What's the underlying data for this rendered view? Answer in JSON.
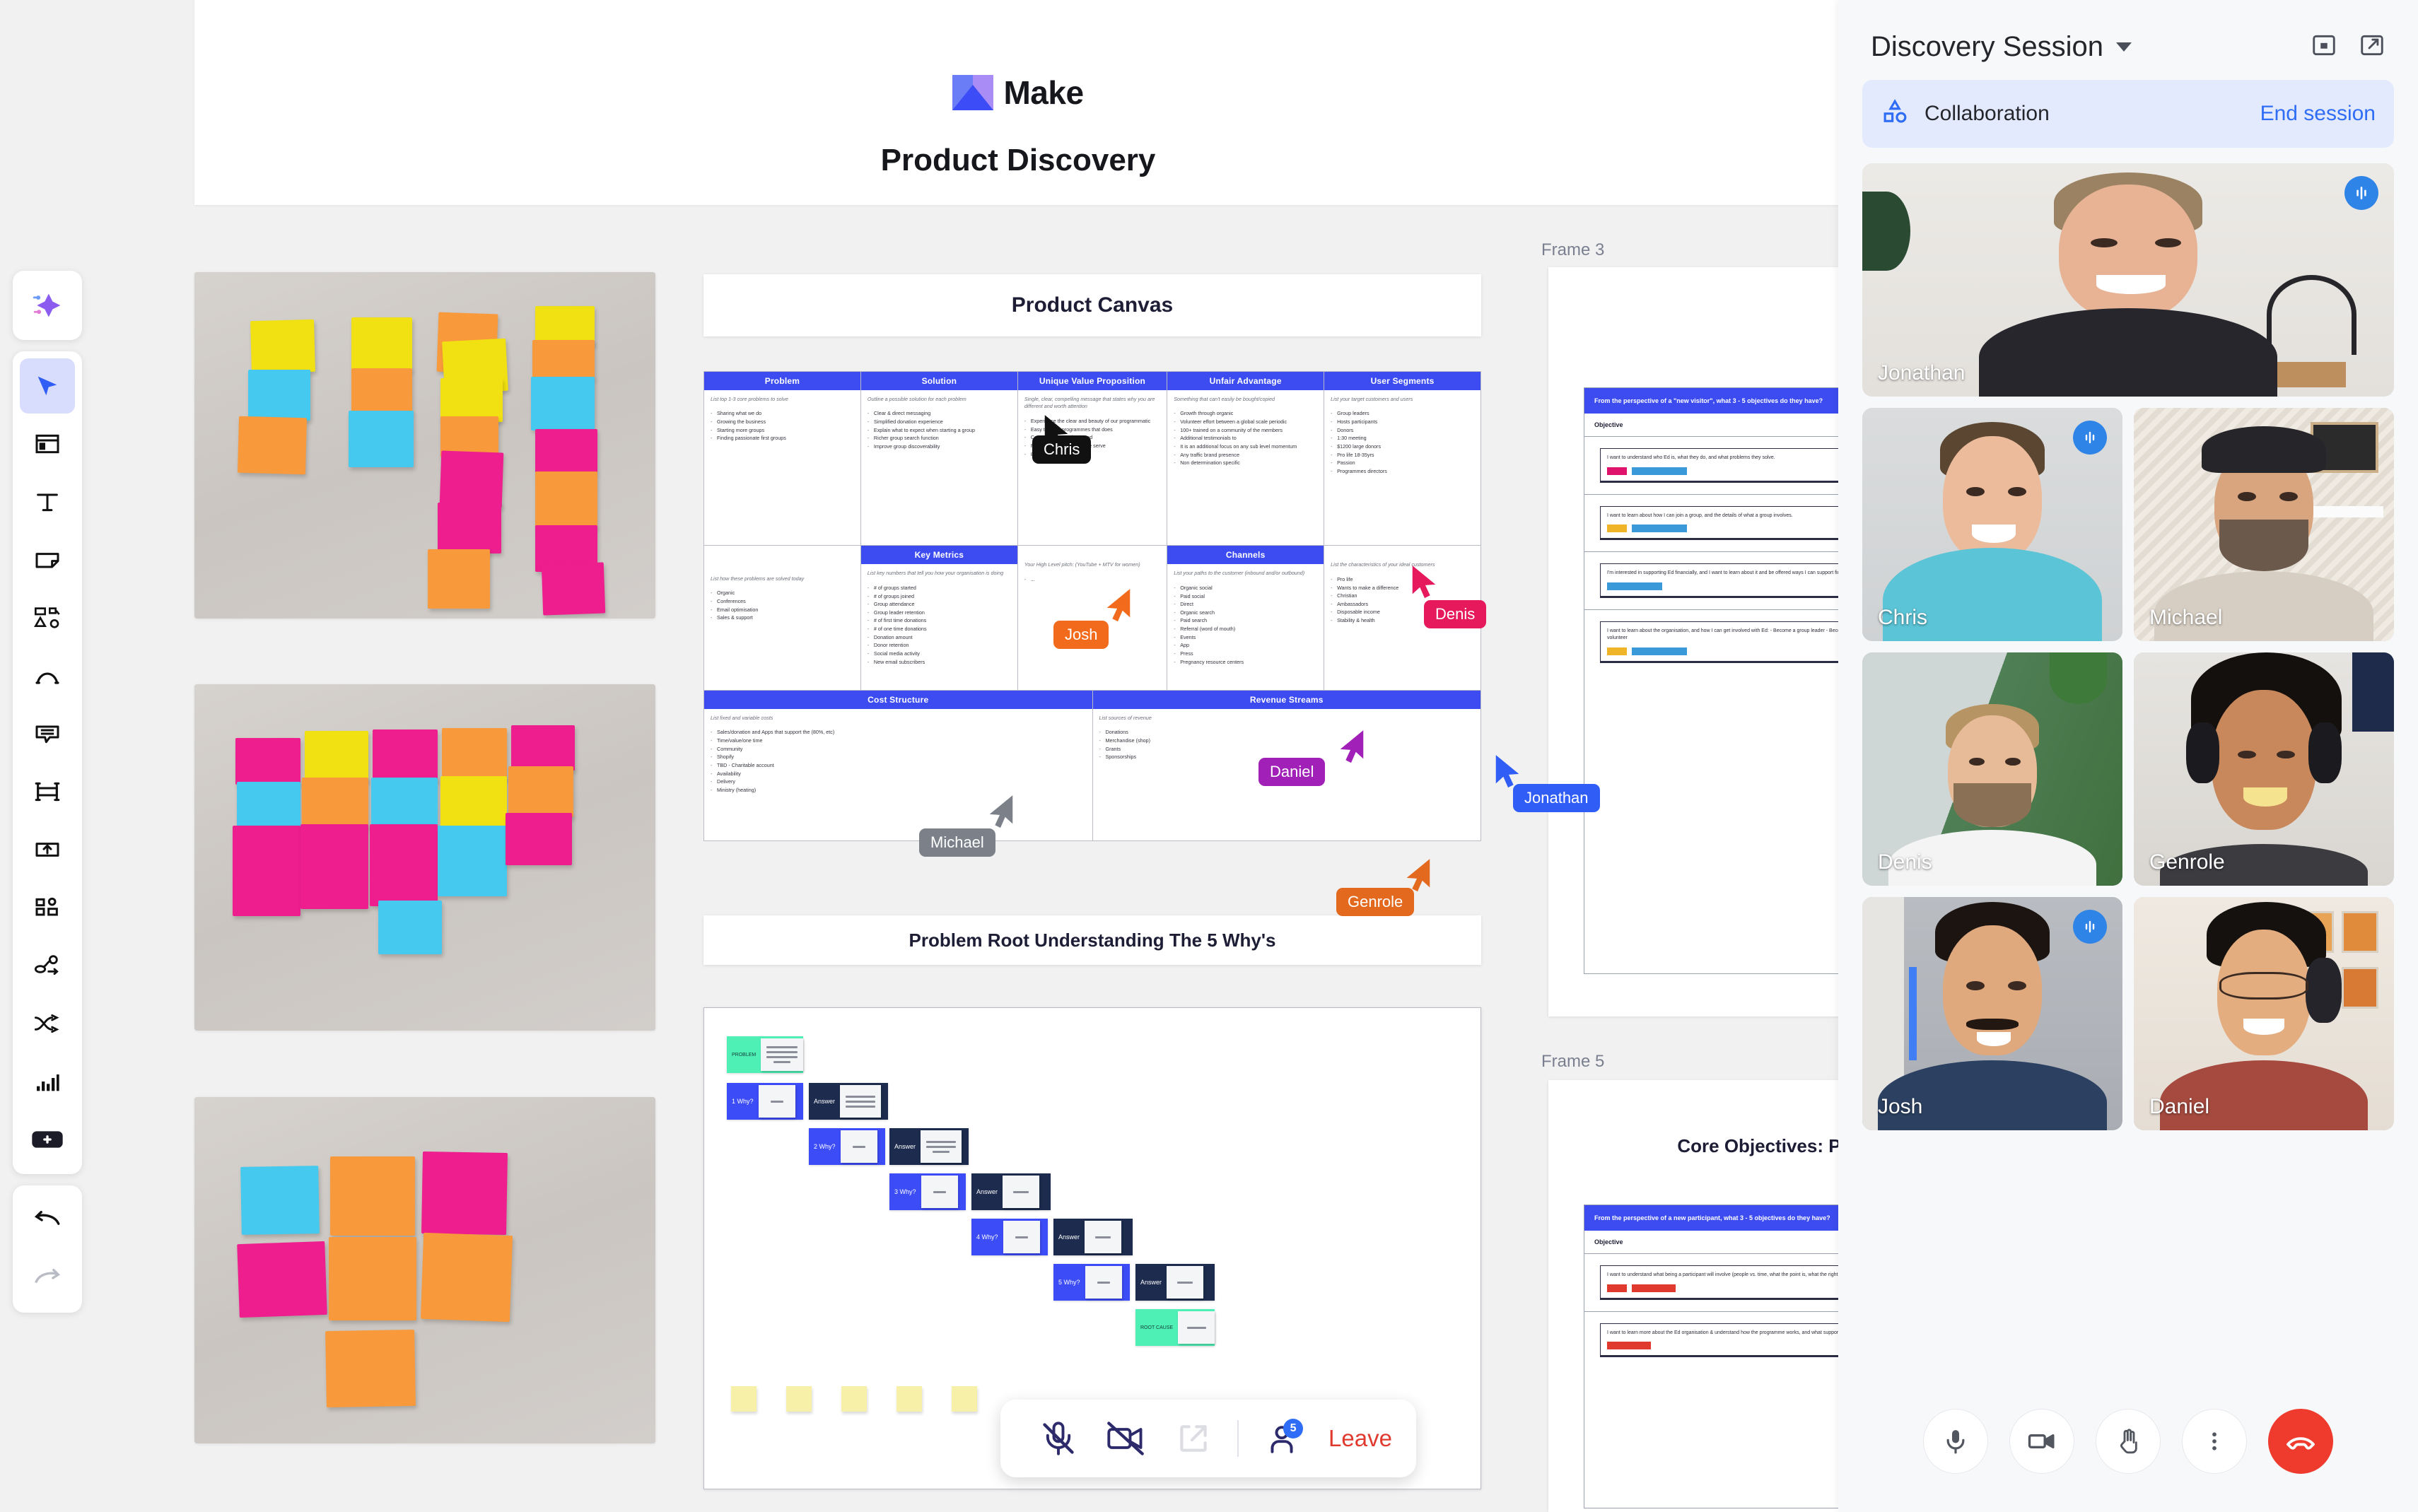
{
  "board": {
    "brand_name": "Make",
    "title": "Product Discovery"
  },
  "toolbar": {
    "items": [
      {
        "name": "ai-assist-icon",
        "label": "AI assist"
      },
      {
        "name": "select-tool",
        "label": "Select",
        "active": true
      },
      {
        "name": "frame-tool",
        "label": "Frame"
      },
      {
        "name": "text-tool",
        "label": "Text"
      },
      {
        "name": "sticky-note-tool",
        "label": "Sticky note"
      },
      {
        "name": "shapes-tool",
        "label": "Shapes"
      },
      {
        "name": "pen-tool",
        "label": "Pen"
      },
      {
        "name": "comment-tool",
        "label": "Comment"
      },
      {
        "name": "table-tool",
        "label": "Table"
      },
      {
        "name": "upload-tool",
        "label": "Upload"
      },
      {
        "name": "apps-tool",
        "label": "Apps"
      },
      {
        "name": "flow-tool",
        "label": "Flow"
      },
      {
        "name": "connector-tool",
        "label": "Connector"
      },
      {
        "name": "chart-tool",
        "label": "Chart"
      },
      {
        "name": "more-tool",
        "label": "More"
      },
      {
        "name": "undo-button",
        "label": "Undo"
      },
      {
        "name": "redo-button",
        "label": "Redo"
      }
    ]
  },
  "canvas": {
    "frames": [
      {
        "label": "Frame 3"
      },
      {
        "label": "Frame 5"
      }
    ],
    "product_canvas": {
      "title": "Product Canvas",
      "columns": [
        {
          "header": "Problem",
          "hint": "List top 1-3 core problems to solve",
          "items": [
            "Sharing what we do",
            "Growing the business",
            "Starting more groups",
            "Finding passionate first groups"
          ]
        },
        {
          "header": "Solution",
          "hint": "Outline a possible solution for each problem",
          "items": [
            "Clear & direct messaging",
            "Simplified donation experience",
            "Explain what to expect when starting a group",
            "Richer group search function",
            "Improve group discoverability"
          ]
        },
        {
          "header": "Unique Value Proposition",
          "hint": "Single, clear, compelling message that states why you are different and worth attention",
          "items": [
            "Experience the clear and beauty of our programmatic",
            "Easy to bring programmes that does",
            "Compel message is around",
            "Focused on the leaders we serve",
            "87% validation rate"
          ]
        },
        {
          "header": "Unfair Advantage",
          "hint": "Something that can't easily be bought/copied",
          "items": [
            "Growth through organic",
            "Volunteer effort between a global scale periodic",
            "100+ trained on a community of the members",
            "Additional testimonials to",
            "It is an additional focus on any sub level momentum",
            "Any traffic brand presence",
            "Non determination specific"
          ]
        },
        {
          "header": "User Segments",
          "hint": "List your target customers and users",
          "items": [
            "Group leaders",
            "Hosts participants",
            "Donors",
            "1:30 meeting",
            "$1200 large donors",
            "Pro life 18-35yrs",
            "Passion",
            "Programmes directors"
          ]
        }
      ],
      "mid_row": [
        {
          "header": "Key Metrics",
          "hint": "List key numbers that tell you how your organisation is doing",
          "items": [
            "# of groups started",
            "# of groups joined",
            "Group attendance",
            "Group leader retention",
            "# of first time donations",
            "# of one time donations",
            "Donation amount",
            "Donor retention",
            "Social media activity",
            "New email subscribers"
          ]
        },
        {
          "header": "Channels",
          "hint": "List your paths to the customer (inbound and/or outbound)",
          "items": [
            "Organic social",
            "Paid social",
            "Direct",
            "Organic search",
            "Paid search",
            "Referral (word of mouth)",
            "Events",
            "App",
            "Press",
            "Pregnancy resource centers"
          ]
        }
      ],
      "uvp_sub": {
        "hint": "Your High Level pitch:  (YouTube + MTV for women)",
        "items": [
          "..."
        ]
      },
      "segments_sub": {
        "hint": "List the characteristics of your ideal customers",
        "items": [
          "Pro life",
          "Wants to make a difference",
          "Christian",
          "Ambassadors",
          "Disposable income",
          "Stability & health"
        ]
      },
      "bottom": [
        {
          "header": "Cost Structure",
          "hint": "List fixed and variable costs",
          "items": [
            "Sales/donation and Apps that support the (80%, etc)",
            "Time/value/one time",
            "Community",
            "Shopify",
            "TBD - Charitable account",
            "Availability",
            "Delivery",
            "Ministry (heating)"
          ]
        },
        {
          "header": "Revenue Streams",
          "hint": "List sources of revenue",
          "items": [
            "Donations",
            "Merchandise (shop)",
            "Grants",
            "Sponsorships"
          ]
        }
      ]
    },
    "five_whys": {
      "title": "Problem Root Understanding The 5 Why's",
      "nodes": [
        {
          "label": "PROBLEM",
          "kind": "problem"
        },
        {
          "label": "1 Why?",
          "kind": "why"
        },
        {
          "label": "Answer",
          "kind": "answer"
        },
        {
          "label": "2 Why?",
          "kind": "why"
        },
        {
          "label": "Answer",
          "kind": "answer"
        },
        {
          "label": "3 Why?",
          "kind": "why"
        },
        {
          "label": "Answer",
          "kind": "answer"
        },
        {
          "label": "4 Why?",
          "kind": "why"
        },
        {
          "label": "Answer",
          "kind": "answer"
        },
        {
          "label": "5 Why?",
          "kind": "why"
        },
        {
          "label": "Answer",
          "kind": "answer"
        },
        {
          "label": "ROOT CAUSE",
          "kind": "root"
        }
      ]
    },
    "interviews": [
      {
        "question": "From the perspective of a \"new visitor\", what 3 - 5 objectives do they have?",
        "objective_label": "Objective",
        "notes": [
          {
            "text": "I want to understand who Ed is, what they do, and what problems they solve.",
            "tags": [
              "#e0136c",
              "#3a9ad9"
            ]
          },
          {
            "text": "I want to learn about how I can join a group, and the details of what a group involves.",
            "tags": [
              "#f0b429",
              "#3a9ad9"
            ]
          },
          {
            "text": "I'm interested in supporting Ed financially, and I want to learn about it and be offered ways I can support financially (cash, stock, etc).",
            "tags": [
              "#3a9ad9"
            ]
          },
          {
            "text": "I want to learn about the organisation, and how I can get involved with Ed: - Become a group leader - Become an ambassador/volunteer/long-term advocate, share with my community - Become a volunteer",
            "tags": [
              "#f0b429",
              "#3a9ad9"
            ]
          }
        ]
      },
      {
        "title": "Core Objectives: Potential Participant",
        "question": "From the perspective of a new participant, what 3 - 5 objectives do they have?",
        "objective_label": "Objective",
        "notes": [
          {
            "text": "I want to understand what being a participant will involve (people vs. time, what the point is, what the right next step for me/my situation).",
            "tags": [
              "#e03a2f",
              "#e03a2f"
            ]
          },
          {
            "text": "I want to learn more about the Ed organisation & understand how the programme works, and what support is available to me.",
            "tags": [
              "#e03a2f"
            ]
          }
        ]
      }
    ],
    "cursors": [
      {
        "name": "Chris",
        "color": "#111111"
      },
      {
        "name": "Josh",
        "color": "#f26a1b"
      },
      {
        "name": "Denis",
        "color": "#e5195c"
      },
      {
        "name": "Daniel",
        "color": "#a020b8"
      },
      {
        "name": "Michael",
        "color": "#7b8089"
      },
      {
        "name": "Jonathan",
        "color": "#2f5df6"
      },
      {
        "name": "Genrole",
        "color": "#e2691e"
      }
    ],
    "meeting_bar": {
      "mic_label": "Microphone muted",
      "camera_label": "Camera off",
      "share_label": "Share screen",
      "participants_count": "5",
      "leave_label": "Leave"
    }
  },
  "panel": {
    "title": "Discovery Session",
    "collapse_icon": "panel-collapse-icon",
    "popout_icon": "open-external-icon",
    "collaboration": {
      "icon": "collaboration-shapes-icon",
      "label": "Collaboration",
      "end_label": "End session"
    },
    "participants": [
      {
        "name": "Jonathan",
        "size": "big",
        "speaking": true
      },
      {
        "name": "Chris",
        "size": "sm",
        "speaking": true
      },
      {
        "name": "Michael",
        "size": "sm",
        "speaking": false
      },
      {
        "name": "Denis",
        "size": "sm",
        "speaking": false
      },
      {
        "name": "Genrole",
        "size": "sm",
        "speaking": false
      },
      {
        "name": "Josh",
        "size": "sm",
        "speaking": true
      },
      {
        "name": "Daniel",
        "size": "sm",
        "speaking": false
      }
    ],
    "controls": [
      {
        "name": "microphone-button",
        "label": "Mute"
      },
      {
        "name": "camera-button",
        "label": "Camera"
      },
      {
        "name": "raise-hand-button",
        "label": "Raise hand"
      },
      {
        "name": "more-options-button",
        "label": "More"
      },
      {
        "name": "hang-up-button",
        "label": "Leave call"
      }
    ]
  },
  "colors": {
    "accent": "#3c4cf6",
    "panel_bg": "#f7f8fa",
    "canvas_bg": "#f1f1f1",
    "danger": "#ef3b2d",
    "link": "#2f6df6"
  }
}
